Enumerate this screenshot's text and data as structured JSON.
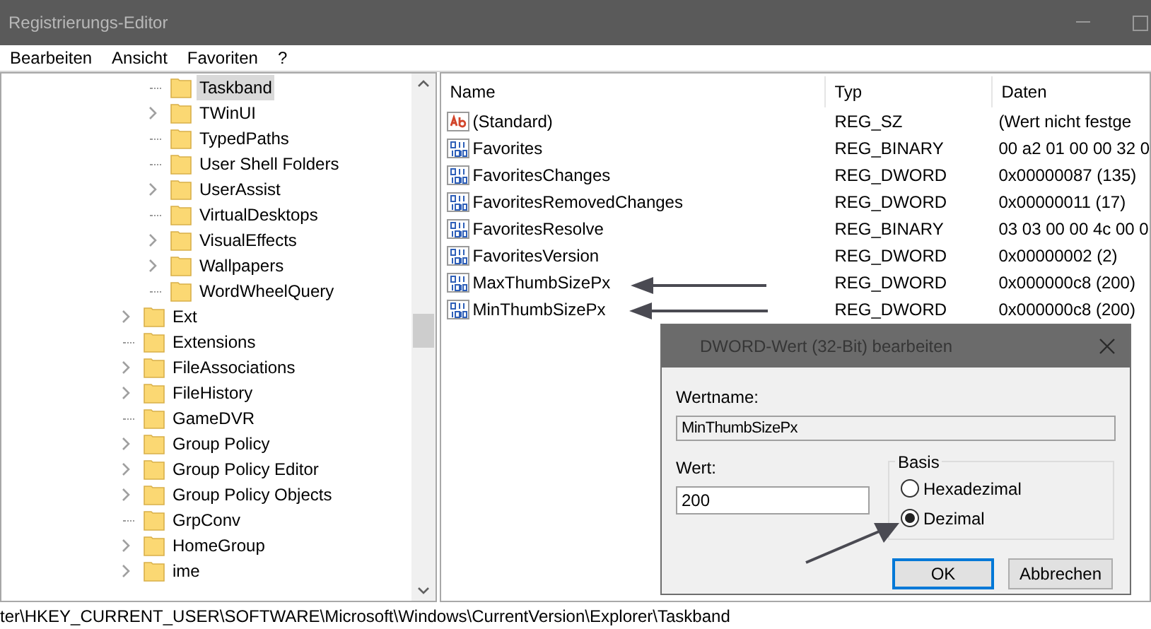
{
  "window": {
    "title": "Registrierungs-Editor"
  },
  "menu": [
    "Bearbeiten",
    "Ansicht",
    "Favoriten",
    "?"
  ],
  "tree": [
    {
      "children": [
        {
          "label": "Taskband",
          "expandable": false,
          "selected": true
        },
        {
          "label": "TWinUI",
          "expandable": true,
          "selected": false
        },
        {
          "label": "TypedPaths",
          "expandable": false,
          "selected": false
        },
        {
          "label": "User Shell Folders",
          "expandable": false,
          "selected": false
        },
        {
          "label": "UserAssist",
          "expandable": true,
          "selected": false
        },
        {
          "label": "VirtualDesktops",
          "expandable": false,
          "selected": false
        },
        {
          "label": "VisualEffects",
          "expandable": true,
          "selected": false
        },
        {
          "label": "Wallpapers",
          "expandable": true,
          "selected": false
        },
        {
          "label": "WordWheelQuery",
          "expandable": false,
          "selected": false
        }
      ]
    },
    {
      "label": "Ext",
      "expandable": true,
      "selected": false
    },
    {
      "label": "Extensions",
      "expandable": false,
      "selected": false
    },
    {
      "label": "FileAssociations",
      "expandable": true,
      "selected": false
    },
    {
      "label": "FileHistory",
      "expandable": true,
      "selected": false
    },
    {
      "label": "GameDVR",
      "expandable": false,
      "selected": false
    },
    {
      "label": "Group Policy",
      "expandable": true,
      "selected": false
    },
    {
      "label": "Group Policy Editor",
      "expandable": true,
      "selected": false
    },
    {
      "label": "Group Policy Objects",
      "expandable": true,
      "selected": false
    },
    {
      "label": "GrpConv",
      "expandable": false,
      "selected": false
    },
    {
      "label": "HomeGroup",
      "expandable": true,
      "selected": false
    },
    {
      "label": "ime",
      "expandable": true,
      "selected": false
    }
  ],
  "values": {
    "columns": [
      "Name",
      "Typ",
      "Daten"
    ],
    "rows": [
      {
        "kind": "string",
        "name": "(Standard)",
        "type": "REG_SZ",
        "data": "(Wert nicht festge"
      },
      {
        "kind": "binary",
        "name": "Favorites",
        "type": "REG_BINARY",
        "data": "00 a2 01 00 00 32 0"
      },
      {
        "kind": "binary",
        "name": "FavoritesChanges",
        "type": "REG_DWORD",
        "data": "0x00000087 (135)"
      },
      {
        "kind": "binary",
        "name": "FavoritesRemovedChanges",
        "type": "REG_DWORD",
        "data": "0x00000011 (17)"
      },
      {
        "kind": "binary",
        "name": "FavoritesResolve",
        "type": "REG_BINARY",
        "data": "03 03 00 00 4c 00 0"
      },
      {
        "kind": "binary",
        "name": "FavoritesVersion",
        "type": "REG_DWORD",
        "data": "0x00000002 (2)"
      },
      {
        "kind": "binary",
        "name": "MaxThumbSizePx",
        "type": "REG_DWORD",
        "data": "0x000000c8 (200)"
      },
      {
        "kind": "binary",
        "name": "MinThumbSizePx",
        "type": "REG_DWORD",
        "data": "0x000000c8 (200)"
      }
    ]
  },
  "dialog": {
    "title": "DWORD-Wert (32-Bit) bearbeiten",
    "name_label": "Wertname:",
    "name_value": "MinThumbSizePx",
    "value_label": "Wert:",
    "value": "200",
    "base_label": "Basis",
    "bases": [
      {
        "label": "Hexadezimal",
        "selected": false
      },
      {
        "label": "Dezimal",
        "selected": true
      }
    ],
    "buttons": [
      "OK",
      "Abbrechen"
    ]
  },
  "status_bar": "ter\\HKEY_CURRENT_USER\\SOFTWARE\\Microsoft\\Windows\\CurrentVersion\\Explorer\\Taskband"
}
